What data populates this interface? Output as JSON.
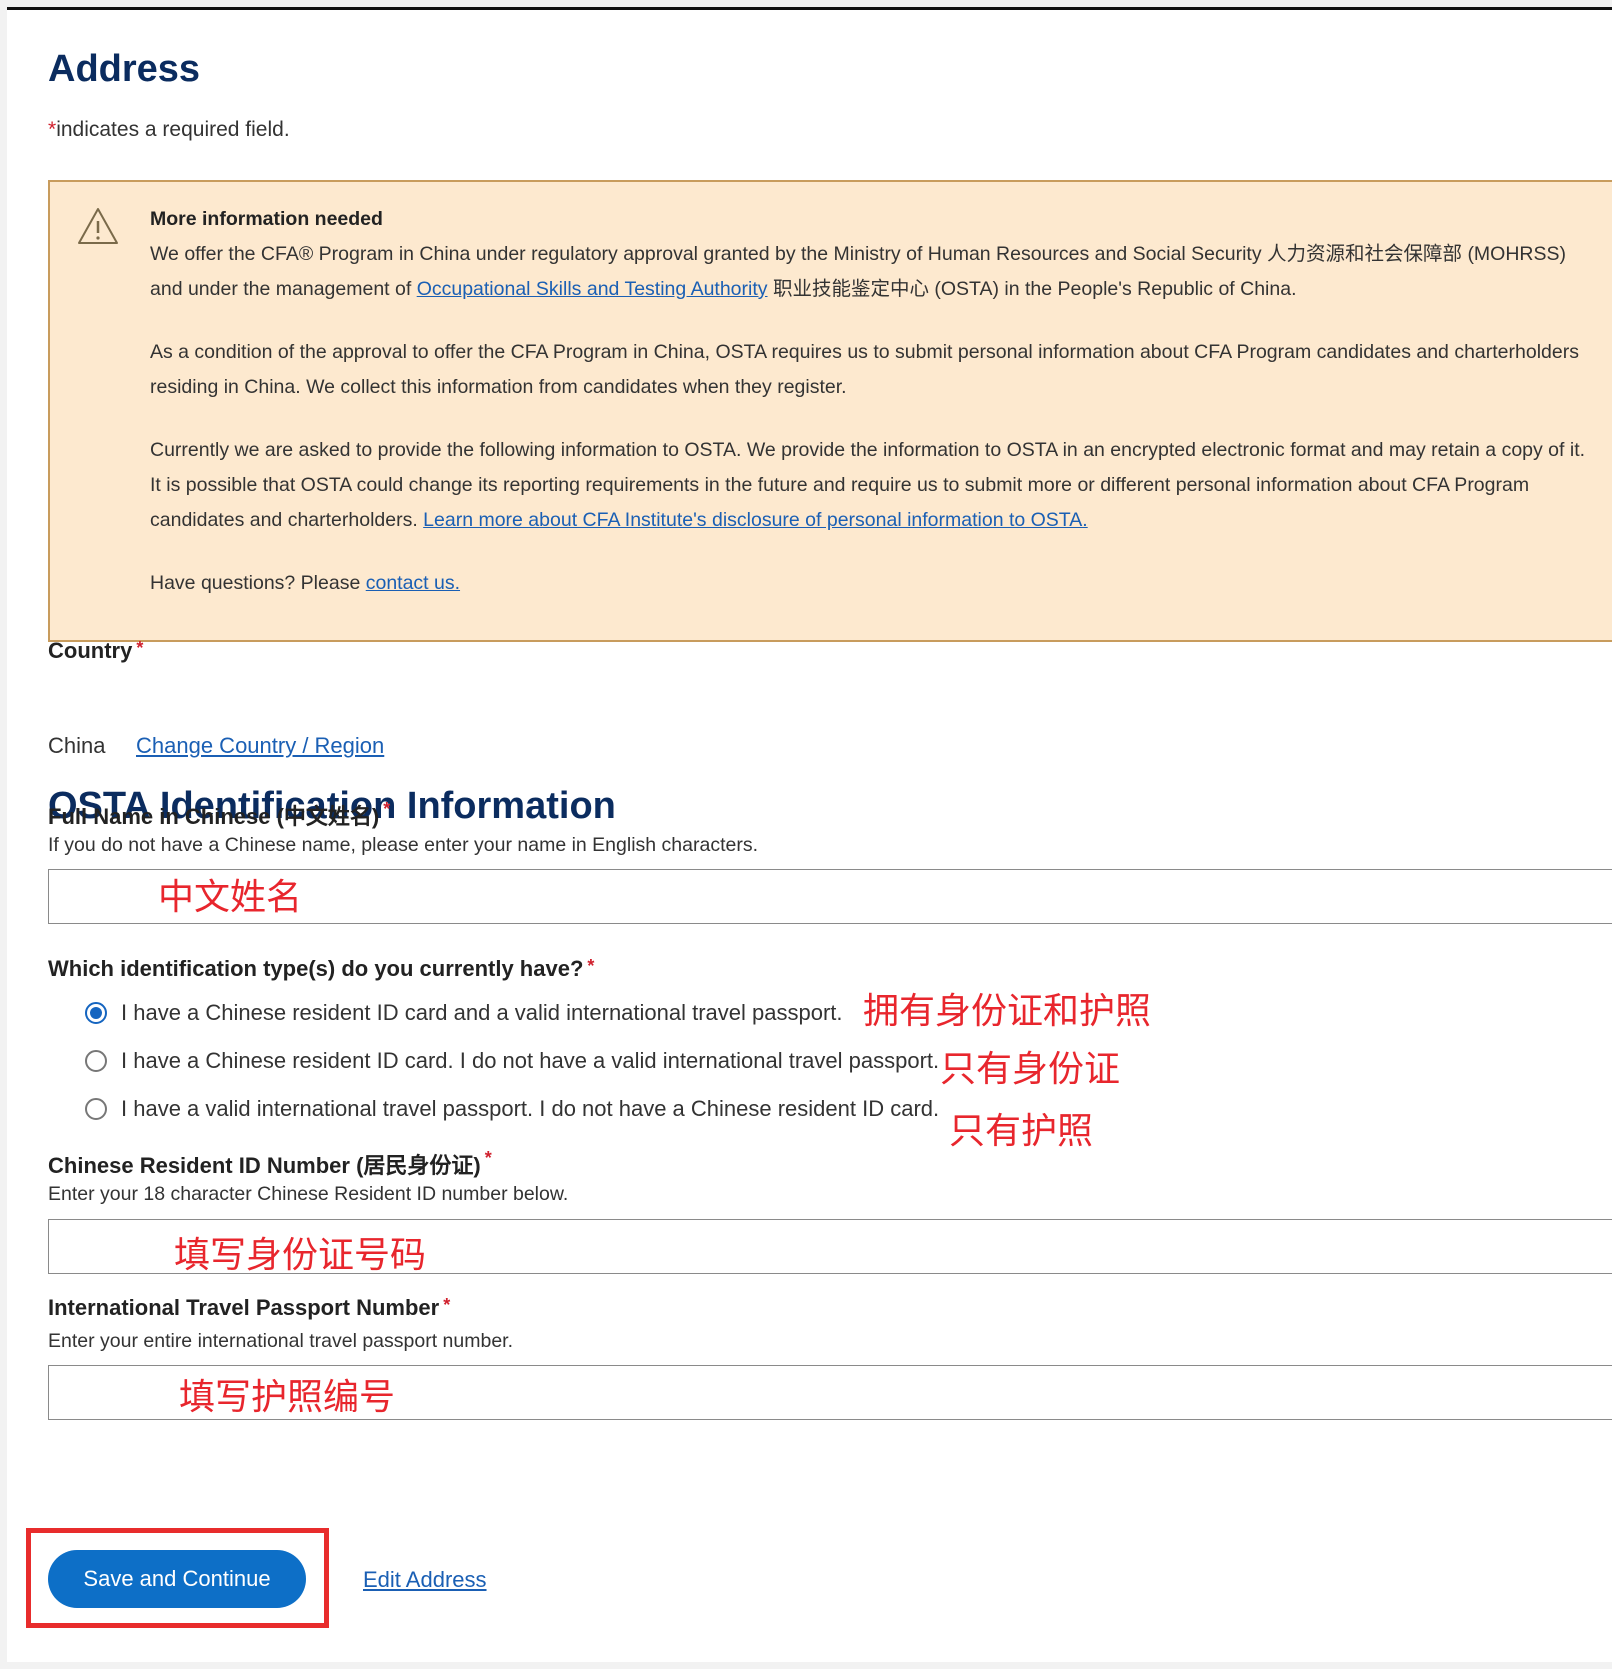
{
  "page": {
    "title": "Address",
    "required_star": "*",
    "required_note": "indicates a required field."
  },
  "info_box": {
    "icon": "warning-triangle-icon",
    "title": "More information needed",
    "p1_before": "We offer the CFA® Program in China under regulatory approval granted by the Ministry of Human Resources and Social Security 人力资源和社会保障部 (MOHRSS) and under the management of ",
    "p1_link": "Occupational Skills and Testing Authority",
    "p1_after": " 职业技能鉴定中心 (OSTA) in the People's Republic of China.",
    "p2": "As a condition of the approval to offer the CFA Program in China, OSTA requires us to submit personal information about CFA Program candidates and charterholders residing in China. We collect this information from candidates when they register.",
    "p3_before": "Currently we are asked to provide the following information to OSTA. We provide the information to OSTA in an encrypted electronic format and may retain a copy of it. It is possible that OSTA could change its reporting requirements in the future and require us to submit more or different personal information about CFA Program candidates and charterholders. ",
    "p3_link": "Learn more about CFA Institute's disclosure of personal information to OSTA.",
    "p4_before": "Have questions? Please ",
    "p4_link": "contact us."
  },
  "country": {
    "label": "Country",
    "value": "China",
    "change_link": "Change Country / Region"
  },
  "osta": {
    "title": "OSTA Identification Information",
    "full_name": {
      "label": "Full Name in Chinese (中文姓名)",
      "help": "If you do not have a Chinese name, please enter your name in English characters.",
      "value": "",
      "annotation": "中文姓名"
    },
    "id_type": {
      "label": "Which identification type(s) do you currently have?",
      "options": [
        {
          "label": "I have a Chinese resident ID card and a valid international travel passport.",
          "checked": true,
          "annotation": "拥有身份证和护照"
        },
        {
          "label": "I have a Chinese resident ID card. I do not have a valid international travel passport.",
          "checked": false,
          "annotation": "只有身份证"
        },
        {
          "label": "I have a valid international travel passport. I do not have a Chinese resident ID card.",
          "checked": false,
          "annotation": "只有护照"
        }
      ]
    },
    "resident_id": {
      "label": "Chinese Resident ID Number (居民身份证)",
      "help": "Enter your 18 character Chinese Resident ID number below.",
      "value": "",
      "annotation": "填写身份证号码"
    },
    "passport": {
      "label": "International Travel Passport Number",
      "help": "Enter your entire international travel passport number.",
      "value": "",
      "annotation": "填写护照编号"
    }
  },
  "actions": {
    "save_label": "Save and Continue",
    "edit_link": "Edit Address"
  },
  "colors": {
    "heading": "#0b2c5f",
    "link": "#1a5fb4",
    "primary_button": "#0d6fc7",
    "required_star": "#d0202d",
    "warning_bg": "#fde9cf",
    "warning_border": "#c89c5d",
    "annotation": "#e8262d"
  }
}
